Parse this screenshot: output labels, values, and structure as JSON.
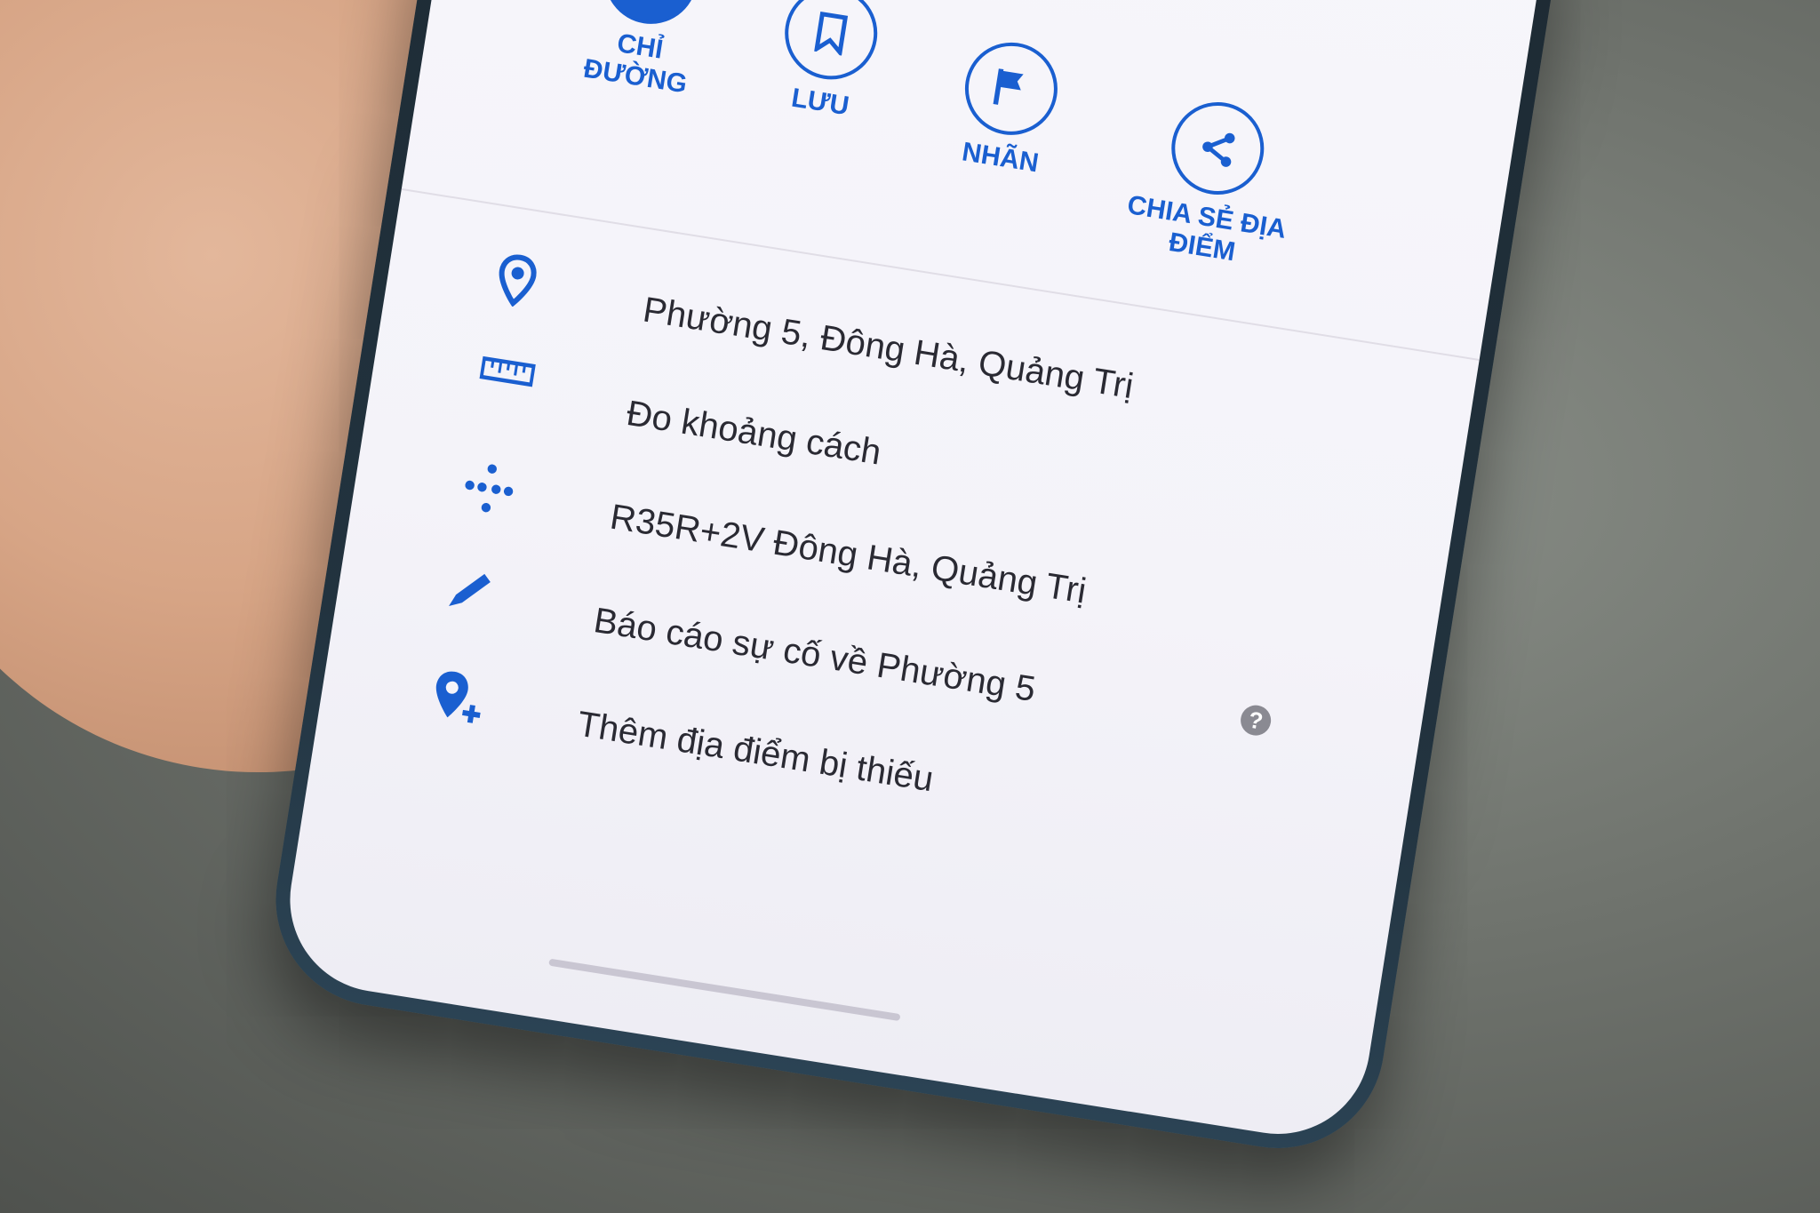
{
  "actions": [
    {
      "label": "CHỈ ĐƯỜNG",
      "icon": "directions-icon"
    },
    {
      "label": "LƯU",
      "icon": "bookmark-icon"
    },
    {
      "label": "NHÃN",
      "icon": "flag-icon"
    },
    {
      "label": "CHIA SẺ ĐỊA ĐIỂM",
      "icon": "share-icon"
    }
  ],
  "rows": [
    {
      "text": "Phường 5, Đông Hà, Quảng Trị",
      "icon": "location-pin-icon"
    },
    {
      "text": "Đo khoảng cách",
      "icon": "ruler-icon"
    },
    {
      "text": "R35R+2V Đông Hà, Quảng Trị",
      "icon": "plus-code-icon"
    },
    {
      "text": "Báo cáo sự cố về Phường 5",
      "icon": "pencil-icon"
    },
    {
      "text": "Thêm địa điểm bị thiếu",
      "icon": "add-place-icon"
    }
  ],
  "help_glyph": "?",
  "colors": {
    "accent": "#1a5fd0",
    "text": "#2a2a33",
    "screen": "#f5f4fa"
  }
}
